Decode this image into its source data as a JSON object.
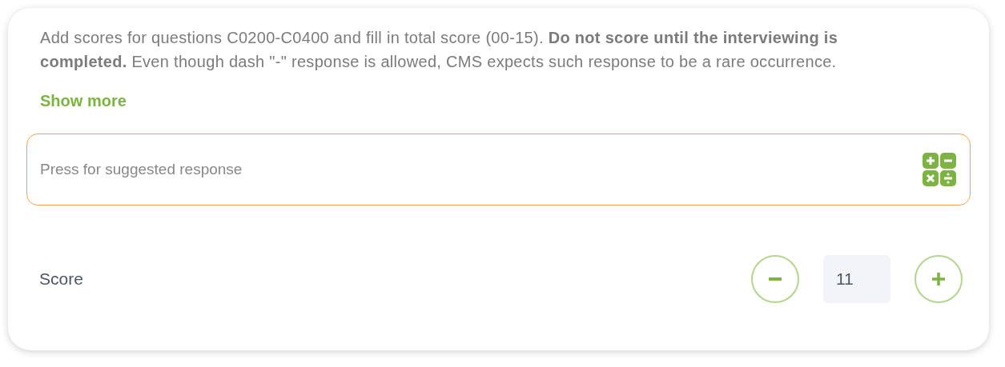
{
  "instructions": "Add scores for questions C0200-C0400 and fill in total score (00-15). **Do not score until the interviewing is completed.** Even though dash \"-\" response is allowed, CMS expects such response to be a rare occurrence.",
  "show_more": "Show more",
  "suggestion_field": {
    "placeholder": "Press for suggested response"
  },
  "score": {
    "label": "Score",
    "value": "11"
  }
}
